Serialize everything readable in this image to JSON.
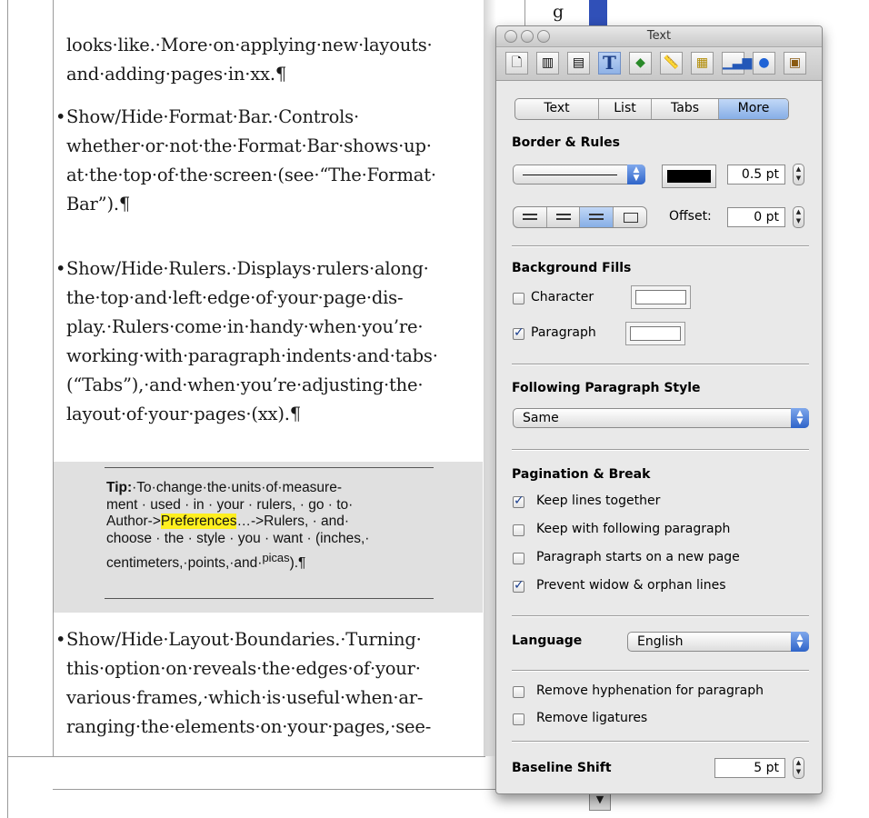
{
  "document": {
    "para1": [
      "looks·like.·More·on·applying·new·layouts·",
      "and·adding·pages·in·xx.¶"
    ],
    "para2": [
      "Show/Hide·Format·Bar.·Controls·",
      "whether·or·not·the·Format·Bar·shows·up·",
      "at·the·top·of·the·screen·(see·“The·Format·",
      "Bar”).¶"
    ],
    "para3": [
      "Show/Hide·Rulers.·Displays·rulers·along·",
      "the·top·and·left·edge·of·your·page·dis-",
      "play.·Rulers·come·in·handy·when·you’re·",
      "working·with·paragraph·indents·and·tabs·",
      "(“Tabs”),·and·when·you’re·adjusting·the·",
      "layout·of·your·pages·(xx).¶"
    ],
    "tip": {
      "label": "Tip:",
      "line1": "·To·change·the·units·of·measure-",
      "line2": "ment · used · in · your · rulers, · go · to·",
      "line3_a": "Author->",
      "line3_highlight": "Preferences",
      "line3_b": "…->Rulers, · and·",
      "line4": "choose · the · style · you · want · (inches,·",
      "line5_a": "centimeters,·points,·and·",
      "line5_sup": "picas",
      "line5_b": ").¶"
    },
    "para4": [
      "Show/Hide·Layout·Boundaries.·Turning·",
      "this·option·on·reveals·the·edges·of·your·",
      "various·frames,·which·is·useful·when·ar-",
      "ranging·the·elements·on·your·pages,·see-"
    ],
    "ghost_char": "g"
  },
  "panel": {
    "title": "Text",
    "toolbar_icons": [
      "document-icon",
      "layout-icon",
      "wrap-icon",
      "text-icon",
      "graphic-icon",
      "metrics-icon",
      "table-icon",
      "chart-icon",
      "link-icon",
      "quicktime-icon"
    ],
    "tabs": [
      {
        "label": "Text",
        "active": false
      },
      {
        "label": "List",
        "active": false
      },
      {
        "label": "Tabs",
        "active": false
      },
      {
        "label": "More",
        "active": true
      }
    ],
    "border_rules": {
      "title": "Border & Rules",
      "width_value": "0.5 pt",
      "color": "#000000",
      "offset_label": "Offset:",
      "offset_value": "0 pt"
    },
    "background_fills": {
      "title": "Background Fills",
      "character_label": "Character",
      "character_checked": false,
      "paragraph_label": "Paragraph",
      "paragraph_checked": true
    },
    "following_style": {
      "title": "Following Paragraph Style",
      "value": "Same"
    },
    "pagination": {
      "title": "Pagination & Break",
      "options": [
        {
          "label": "Keep lines together",
          "checked": true
        },
        {
          "label": "Keep with following paragraph",
          "checked": false
        },
        {
          "label": "Paragraph starts on a new page",
          "checked": false
        },
        {
          "label": "Prevent widow & orphan lines",
          "checked": true
        }
      ]
    },
    "language": {
      "label": "Language",
      "value": "English"
    },
    "hyphenation": {
      "remove_hyphenation_label": "Remove hyphenation for paragraph",
      "remove_hyphenation_checked": false,
      "remove_ligatures_label": "Remove ligatures",
      "remove_ligatures_checked": false
    },
    "baseline": {
      "label": "Baseline Shift",
      "value": "5 pt"
    }
  }
}
